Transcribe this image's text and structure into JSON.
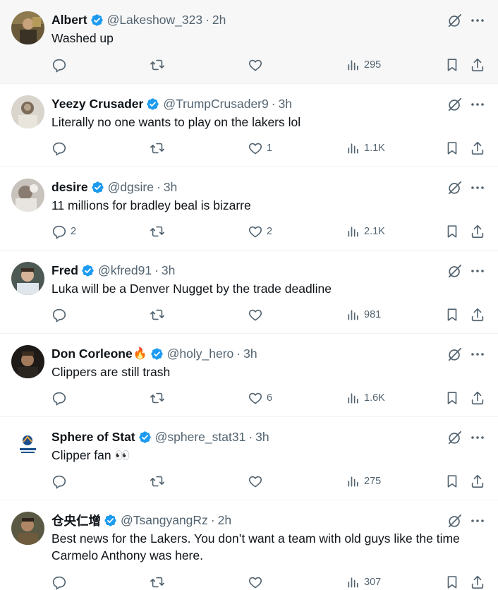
{
  "colors": {
    "verified_badge": "#1d9bf0",
    "secondary_text": "#536471",
    "primary_text": "#0f1419",
    "divider": "#eff3f4",
    "hover_background": "#f7f7f7"
  },
  "icons": {
    "verified": "verified-badge-icon",
    "grok": "grok-icon",
    "more": "more-icon",
    "reply": "reply-icon",
    "retweet": "retweet-icon",
    "like": "like-icon",
    "views": "views-icon",
    "bookmark": "bookmark-icon",
    "share": "share-icon"
  },
  "tweets": [
    {
      "display_name": "Albert",
      "emoji": "",
      "handle": "@Lakeshow_323",
      "time": "2h",
      "text": "Washed up",
      "replies": "",
      "retweets": "",
      "likes": "",
      "views": "295"
    },
    {
      "display_name": "Yeezy Crusader",
      "emoji": "",
      "handle": "@TrumpCrusader9",
      "time": "3h",
      "text": "Literally no one wants to play on the lakers lol",
      "replies": "",
      "retweets": "",
      "likes": "1",
      "views": "1.1K"
    },
    {
      "display_name": "desire",
      "emoji": "",
      "handle": "@dgsire",
      "time": "3h",
      "text": "11 millions for bradley beal is bizarre",
      "replies": "2",
      "retweets": "",
      "likes": "2",
      "views": "2.1K"
    },
    {
      "display_name": "Fred",
      "emoji": "",
      "handle": "@kfred91",
      "time": "3h",
      "text": "Luka will be a Denver Nugget by the trade deadline",
      "replies": "",
      "retweets": "",
      "likes": "",
      "views": "981"
    },
    {
      "display_name": "Don Corleone",
      "emoji": "🔥",
      "handle": "@holy_hero",
      "time": "3h",
      "text": "Clippers are still trash",
      "replies": "",
      "retweets": "",
      "likes": "6",
      "views": "1.6K"
    },
    {
      "display_name": "Sphere of Stat",
      "emoji": "",
      "handle": "@sphere_stat31",
      "time": "3h",
      "text": "Clipper fan 👀",
      "replies": "",
      "retweets": "",
      "likes": "",
      "views": "275"
    },
    {
      "display_name": "仓央仁增",
      "emoji": "",
      "handle": "@TsangyangRz",
      "time": "2h",
      "text": "Best news for the Lakers. You don’t want a team with old guys like the time Carmelo Anthony was here.",
      "replies": "",
      "retweets": "",
      "likes": "",
      "views": "307"
    }
  ]
}
